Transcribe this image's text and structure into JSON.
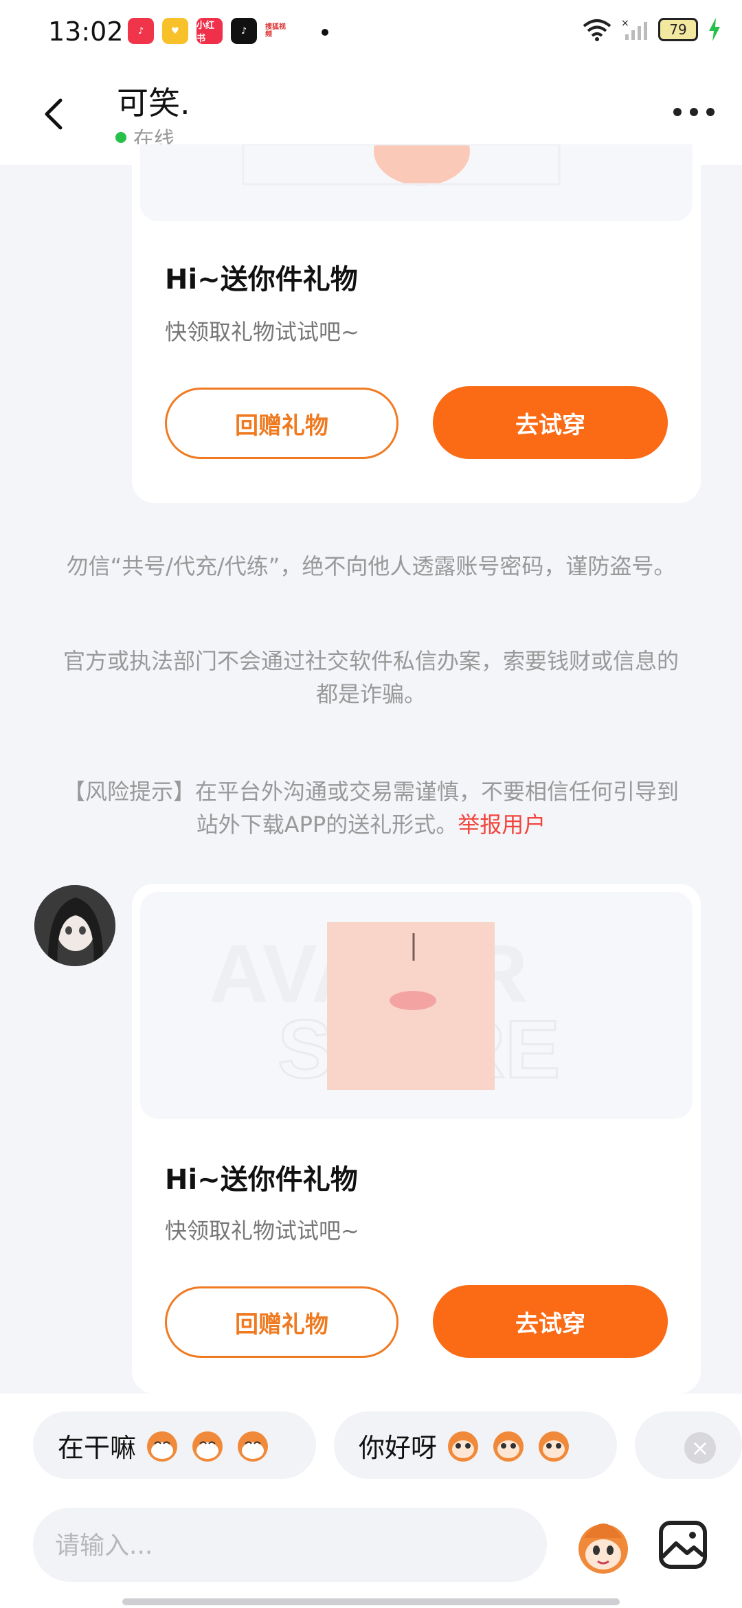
{
  "status_bar": {
    "time": "13:02",
    "battery": "79",
    "apps": [
      "music-app-icon",
      "coupon-app-icon",
      "xiaohongshu-app-icon",
      "tiktok-app-icon",
      "sohu-video-app-icon"
    ],
    "app_labels": {
      "xiaohongshu": "小红书",
      "sohu": "搜狐视频"
    }
  },
  "header": {
    "title": "可笑.",
    "status": "在线"
  },
  "cards": [
    {
      "title": "Hi~送你件礼物",
      "subtitle": "快领取礼物试试吧~",
      "return_gift_label": "回赠礼物",
      "try_on_label": "去试穿"
    },
    {
      "title": "Hi~送你件礼物",
      "subtitle": "快领取礼物试试吧~",
      "return_gift_label": "回赠礼物",
      "try_on_label": "去试穿"
    }
  ],
  "notices": {
    "account_safety": "勿信“共号/代充/代练”，绝不向他人透露账号密码，谨防盗号。",
    "fraud_warning": "官方或执法部门不会通过社交软件私信办案，索要钱财或信息的都是诈骗。",
    "risk_tip": "【风险提示】在平台外沟通或交易需谨慎，不要相信任何引导到站外下载APP的送礼形式。",
    "report_link": "举报用户"
  },
  "quick_replies": [
    {
      "label": "在干嘛"
    },
    {
      "label": "你好呀"
    }
  ],
  "input": {
    "placeholder": "请输入..."
  },
  "colors": {
    "accent": "#fb6a15",
    "report": "#f2453d",
    "online": "#27c04a",
    "background": "#f4f5f9"
  }
}
